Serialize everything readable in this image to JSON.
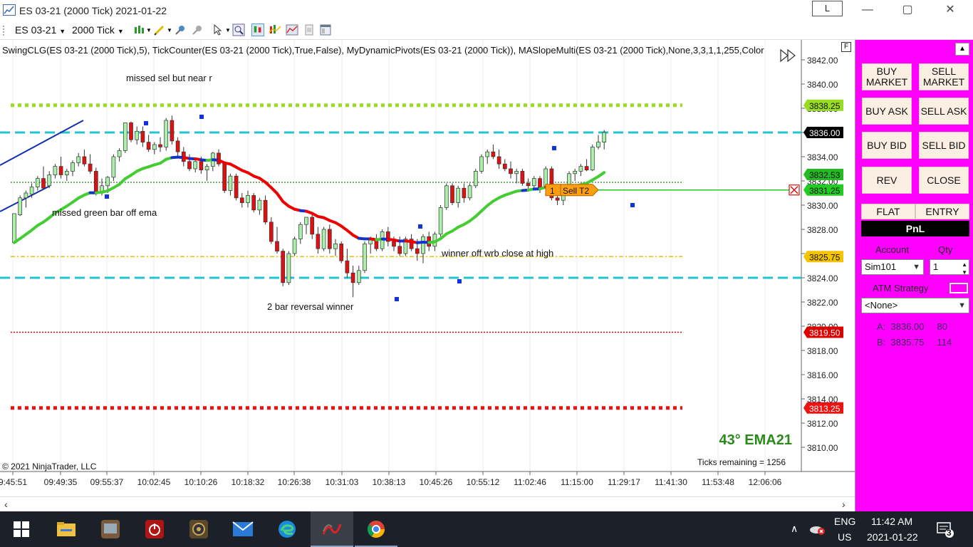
{
  "window": {
    "title": "ES 03-21 (2000 Tick)  2021-01-22",
    "link_button": "L",
    "minimize": "—",
    "maximize": "▢",
    "close": "✕"
  },
  "toolbar": {
    "instrument": "ES 03-21",
    "interval": "2000 Tick"
  },
  "chart": {
    "indicators": "SwingCLG(ES 03-21 (2000 Tick),5), TickCounter(ES 03-21 (2000 Tick),True,False), MyDynamicPivots(ES 03-21 (2000 Tick)), MASlopeMulti(ES 03-21 (2000 Tick),None,3,3,1,1,255,Color",
    "f_button": "F",
    "annotations": [
      {
        "text": "missed sel but near r"
      },
      {
        "text": "missed green bar off ema"
      },
      {
        "text": "winner off wrb close at high"
      },
      {
        "text": "2 bar reversal winner"
      }
    ],
    "ema_label": "43° EMA21",
    "ticks_remaining": "Ticks remaining = 1256",
    "copyright": "© 2021 NinjaTrader, LLC",
    "order_qty": "1",
    "order_label": "Sell T2",
    "price_axis": [
      "3842.00",
      "3840.00",
      "3838.00",
      "3836.00",
      "3834.00",
      "3832.00",
      "3830.00",
      "3828.00",
      "3826.00",
      "3824.00",
      "3822.00",
      "3820.00",
      "3818.00",
      "3816.00",
      "3814.00",
      "3812.00",
      "3810.00"
    ],
    "time_axis": [
      "9:45:51",
      "09:49:35",
      "09:55:37",
      "10:02:45",
      "10:10:26",
      "10:18:32",
      "10:26:38",
      "10:31:03",
      "10:38:13",
      "10:45:26",
      "10:55:12",
      "11:02:46",
      "11:15:00",
      "11:29:17",
      "11:41:30",
      "11:53:48",
      "12:06:06"
    ],
    "price_markers": [
      {
        "label": "3838.25",
        "color": "#99dd22"
      },
      {
        "label": "3836.00",
        "color": "#000000"
      },
      {
        "label": "3832.53",
        "color": "#22bb22"
      },
      {
        "label": "3831.25",
        "color": "#22cc22"
      },
      {
        "label": "3825.75",
        "color": "#f5c400"
      },
      {
        "label": "3819.50",
        "color": "#dd0000"
      },
      {
        "label": "3813.25",
        "color": "#ee1111"
      }
    ],
    "colors": {
      "level_green": "#99dd22",
      "level_cyan": "#22c5d0",
      "level_yellow": "#e6c200",
      "level_red": "#dd0000",
      "ema_green": "#44cc33",
      "ema_red": "#ee0000",
      "ema_blue": "#1133cc",
      "bull_candle": "#aaf0aa",
      "bear_candle": "#dd1111"
    }
  },
  "chart_data": {
    "type": "candlestick",
    "y_range": [
      3809,
      3843
    ],
    "levels": [
      3838.25,
      3836.0,
      3832.0,
      3825.75,
      3824.0,
      3819.5,
      3813.25
    ],
    "candles": [
      [
        3826.9,
        3829.3,
        3826.9,
        3829.3
      ],
      [
        3829.2,
        3830.8,
        3829.1,
        3830.6
      ],
      [
        3830.6,
        3831.2,
        3829.8,
        3831.0
      ],
      [
        3830.9,
        3831.8,
        3830.6,
        3831.5
      ],
      [
        3831.5,
        3832.4,
        3831.2,
        3832.2
      ],
      [
        3832.2,
        3833.2,
        3831.4,
        3831.4
      ],
      [
        3831.6,
        3832.8,
        3831.4,
        3832.5
      ],
      [
        3832.5,
        3833.4,
        3832.2,
        3833.2
      ],
      [
        3833.2,
        3834.0,
        3832.2,
        3832.5
      ],
      [
        3832.5,
        3833.0,
        3832.0,
        3832.8
      ],
      [
        3832.8,
        3833.7,
        3832.4,
        3833.5
      ],
      [
        3833.5,
        3834.3,
        3833.2,
        3834.0
      ],
      [
        3834.0,
        3834.6,
        3833.2,
        3833.4
      ],
      [
        3833.4,
        3834.2,
        3832.6,
        3832.8
      ],
      [
        3832.8,
        3833.1,
        3830.8,
        3831.0
      ],
      [
        3831.0,
        3832.2,
        3830.8,
        3831.6
      ],
      [
        3831.6,
        3832.4,
        3831.0,
        3832.3
      ],
      [
        3832.3,
        3834.2,
        3832.0,
        3834.0
      ],
      [
        3834.0,
        3834.7,
        3833.6,
        3834.5
      ],
      [
        3834.5,
        3836.8,
        3834.3,
        3836.8
      ],
      [
        3836.8,
        3836.9,
        3835.2,
        3835.4
      ],
      [
        3835.4,
        3836.5,
        3835.0,
        3836.1
      ],
      [
        3836.1,
        3836.5,
        3834.8,
        3835.2
      ],
      [
        3835.2,
        3835.8,
        3834.4,
        3834.6
      ],
      [
        3834.6,
        3835.2,
        3834.2,
        3835.0
      ],
      [
        3835.0,
        3835.6,
        3834.4,
        3834.8
      ],
      [
        3834.8,
        3837.2,
        3834.5,
        3837.0
      ],
      [
        3837.0,
        3837.4,
        3835.0,
        3835.3
      ],
      [
        3835.3,
        3835.6,
        3834.0,
        3834.4
      ],
      [
        3834.4,
        3834.8,
        3833.2,
        3833.6
      ],
      [
        3833.6,
        3834.2,
        3832.8,
        3833.0
      ],
      [
        3833.0,
        3833.8,
        3832.7,
        3833.6
      ],
      [
        3833.6,
        3834.0,
        3832.6,
        3832.9
      ],
      [
        3832.9,
        3833.4,
        3832.0,
        3833.2
      ],
      [
        3833.2,
        3834.4,
        3832.8,
        3834.3
      ],
      [
        3834.3,
        3834.6,
        3833.2,
        3833.4
      ],
      [
        3833.4,
        3833.6,
        3831.0,
        3831.2
      ],
      [
        3831.2,
        3832.6,
        3830.8,
        3832.4
      ],
      [
        3832.4,
        3832.6,
        3830.4,
        3830.6
      ],
      [
        3830.6,
        3831.0,
        3829.8,
        3830.2
      ],
      [
        3830.2,
        3831.2,
        3829.8,
        3830.8
      ],
      [
        3830.8,
        3831.0,
        3829.4,
        3829.6
      ],
      [
        3829.6,
        3830.6,
        3829.2,
        3830.4
      ],
      [
        3830.4,
        3830.8,
        3828.4,
        3828.6
      ],
      [
        3828.6,
        3829.0,
        3826.8,
        3827.0
      ],
      [
        3827.0,
        3828.2,
        3826.0,
        3826.2
      ],
      [
        3826.2,
        3826.4,
        3823.3,
        3823.6
      ],
      [
        3823.6,
        3826.2,
        3823.4,
        3826.0
      ],
      [
        3826.0,
        3827.4,
        3825.8,
        3827.2
      ],
      [
        3827.2,
        3828.6,
        3826.8,
        3828.4
      ],
      [
        3828.4,
        3829.0,
        3827.6,
        3829.0
      ],
      [
        3829.0,
        3829.4,
        3827.2,
        3827.6
      ],
      [
        3827.6,
        3828.2,
        3826.0,
        3826.4
      ],
      [
        3826.4,
        3828.2,
        3826.2,
        3828.0
      ],
      [
        3828.0,
        3828.4,
        3826.0,
        3826.4
      ],
      [
        3826.4,
        3827.2,
        3825.8,
        3826.8
      ],
      [
        3826.8,
        3827.0,
        3825.2,
        3825.4
      ],
      [
        3825.4,
        3826.4,
        3824.0,
        3824.4
      ],
      [
        3824.4,
        3825.0,
        3822.4,
        3823.6
      ],
      [
        3823.6,
        3825.0,
        3823.4,
        3824.6
      ],
      [
        3824.6,
        3827.0,
        3824.4,
        3826.8
      ],
      [
        3826.8,
        3827.4,
        3826.0,
        3827.2
      ],
      [
        3827.2,
        3827.6,
        3826.2,
        3826.4
      ],
      [
        3826.4,
        3828.0,
        3826.2,
        3827.8
      ],
      [
        3827.8,
        3828.2,
        3826.6,
        3827.0
      ],
      [
        3827.0,
        3827.4,
        3826.2,
        3826.6
      ],
      [
        3826.6,
        3827.4,
        3825.8,
        3826.0
      ],
      [
        3826.0,
        3827.4,
        3825.8,
        3827.2
      ],
      [
        3827.2,
        3827.6,
        3826.2,
        3826.4
      ],
      [
        3826.4,
        3827.2,
        3825.4,
        3826.0
      ],
      [
        3826.0,
        3827.6,
        3825.2,
        3827.4
      ],
      [
        3827.4,
        3827.8,
        3826.2,
        3826.6
      ],
      [
        3826.6,
        3827.8,
        3826.2,
        3827.6
      ],
      [
        3827.6,
        3830.0,
        3827.4,
        3829.8
      ],
      [
        3829.8,
        3831.8,
        3829.6,
        3831.6
      ],
      [
        3831.6,
        3831.8,
        3830.0,
        3830.2
      ],
      [
        3830.2,
        3831.6,
        3829.8,
        3831.4
      ],
      [
        3831.4,
        3831.8,
        3830.2,
        3830.6
      ],
      [
        3830.6,
        3831.8,
        3830.4,
        3831.6
      ],
      [
        3831.6,
        3833.0,
        3831.4,
        3832.8
      ],
      [
        3832.8,
        3834.2,
        3832.6,
        3834.0
      ],
      [
        3834.0,
        3834.6,
        3833.4,
        3834.4
      ],
      [
        3834.4,
        3835.0,
        3833.8,
        3834.0
      ],
      [
        3834.0,
        3834.6,
        3833.0,
        3833.4
      ],
      [
        3833.4,
        3833.8,
        3832.8,
        3833.0
      ],
      [
        3833.0,
        3833.6,
        3832.2,
        3832.6
      ],
      [
        3832.6,
        3833.0,
        3831.8,
        3832.8
      ],
      [
        3832.8,
        3833.0,
        3831.6,
        3831.8
      ],
      [
        3831.8,
        3832.2,
        3831.2,
        3831.6
      ],
      [
        3831.6,
        3832.4,
        3831.2,
        3832.2
      ],
      [
        3832.2,
        3832.4,
        3831.0,
        3831.4
      ],
      [
        3831.4,
        3833.2,
        3831.2,
        3833.0
      ],
      [
        3833.0,
        3833.2,
        3830.4,
        3830.6
      ],
      [
        3830.6,
        3831.2,
        3830.0,
        3830.4
      ],
      [
        3830.4,
        3831.4,
        3830.0,
        3831.2
      ],
      [
        3831.2,
        3832.8,
        3831.0,
        3832.6
      ],
      [
        3832.6,
        3833.0,
        3832.0,
        3832.8
      ],
      [
        3832.8,
        3833.4,
        3832.4,
        3833.2
      ],
      [
        3833.2,
        3833.8,
        3832.8,
        3832.9
      ],
      [
        3832.9,
        3835.0,
        3832.8,
        3834.8
      ],
      [
        3834.8,
        3835.8,
        3834.6,
        3835.2
      ],
      [
        3835.2,
        3836.2,
        3834.6,
        3836.0
      ]
    ]
  },
  "panel": {
    "buy_market": "BUY MARKET",
    "sell_market": "SELL MARKET",
    "buy_ask": "BUY ASK",
    "sell_ask": "SELL ASK",
    "buy_bid": "BUY BID",
    "sell_bid": "SELL BID",
    "rev": "REV",
    "close": "CLOSE",
    "flat": "FLAT",
    "entry": "ENTRY",
    "pnl": "PnL",
    "account_label": "Account",
    "qty_label": "Qty",
    "account_value": "Sim101",
    "qty_value": "1",
    "atm_label": "ATM Strategy",
    "atm_value": "<None>",
    "ask_line": "A:  3836.00     80",
    "bid_line": "B:  3835.75     114"
  },
  "taskbar": {
    "lang1": "ENG",
    "lang2": "US",
    "time": "11:42 AM",
    "date": "2021-01-22",
    "notif_count": "3"
  }
}
